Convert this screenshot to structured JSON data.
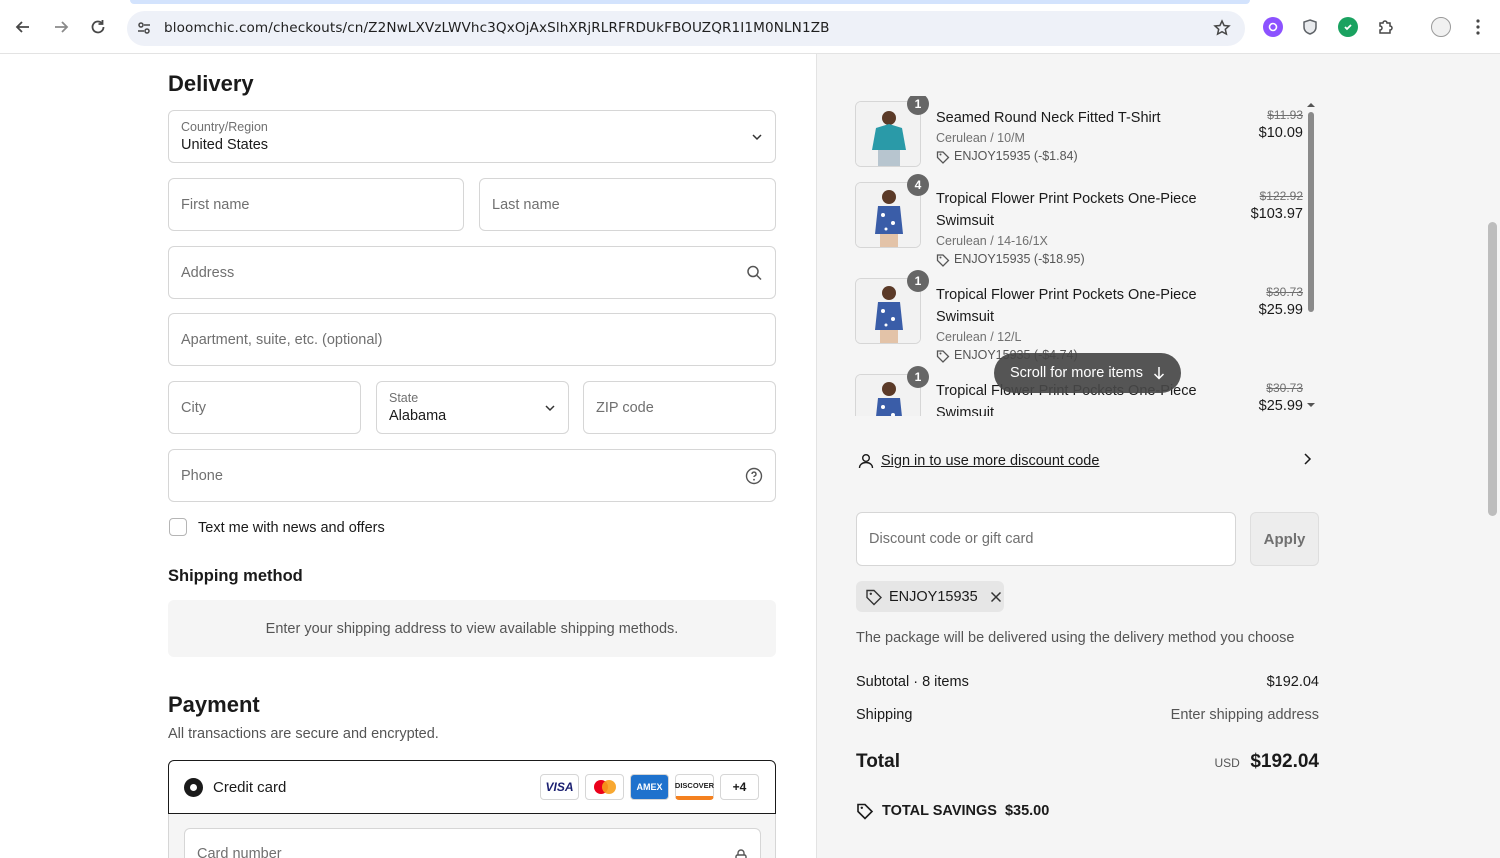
{
  "browser": {
    "url": "bloomchic.com/checkouts/cn/Z2NwLXVzLWVhc3QxOjAxSlhXRjRLRFRDUkFBOUZQR1I1M0NLN1ZB"
  },
  "delivery": {
    "title": "Delivery",
    "country_label": "Country/Region",
    "country_value": "United States",
    "first_name_placeholder": "First name",
    "last_name_placeholder": "Last name",
    "address_placeholder": "Address",
    "apartment_placeholder": "Apartment, suite, etc. (optional)",
    "city_placeholder": "City",
    "state_label": "State",
    "state_value": "Alabama",
    "zip_placeholder": "ZIP code",
    "phone_placeholder": "Phone",
    "newsletter_label": "Text me with news and offers"
  },
  "shipping": {
    "title": "Shipping method",
    "message": "Enter your shipping address to view available shipping methods."
  },
  "payment": {
    "title": "Payment",
    "subtitle": "All transactions are secure and encrypted.",
    "credit_card_label": "Credit card",
    "cards": [
      "VISA",
      "MC",
      "AMEX",
      "DISCOVER"
    ],
    "more_cards": "+4",
    "card_number_placeholder": "Card number"
  },
  "cart": {
    "items": [
      {
        "qty": "1",
        "name": "Seamed Round Neck Fitted T-Shirt",
        "variant": "Cerulean / 10/M",
        "discount": "ENJOY15935 (-$1.84)",
        "old_price": "$11.93",
        "price": "$10.09"
      },
      {
        "qty": "4",
        "name": "Tropical Flower Print Pockets One-Piece Swimsuit",
        "variant": "Cerulean / 14-16/1X",
        "discount": "ENJOY15935 (-$18.95)",
        "old_price": "$122.92",
        "price": "$103.97"
      },
      {
        "qty": "1",
        "name": "Tropical Flower Print Pockets One-Piece Swimsuit",
        "variant": "Cerulean / 12/L",
        "discount": "ENJOY15935 (-$4.74)",
        "old_price": "$30.73",
        "price": "$25.99"
      },
      {
        "qty": "1",
        "name": "Tropical Flower Print Pockets One-Piece Swimsuit",
        "variant": "",
        "discount": "",
        "old_price": "$30.73",
        "price": "$25.99"
      }
    ],
    "scroll_toast": "Scroll for more items"
  },
  "summary": {
    "signin_text": "Sign in to use more discount code",
    "discount_placeholder": "Discount code or gift card",
    "apply_label": "Apply",
    "applied_code": "ENJOY15935",
    "package_note": "The package will be delivered using the delivery method you choose",
    "subtotal_label": "Subtotal · 8 items",
    "subtotal_value": "$192.04",
    "shipping_label": "Shipping",
    "shipping_value": "Enter shipping address",
    "total_label": "Total",
    "total_currency": "USD",
    "total_value": "$192.04",
    "savings_label": "TOTAL SAVINGS",
    "savings_value": "$35.00"
  }
}
